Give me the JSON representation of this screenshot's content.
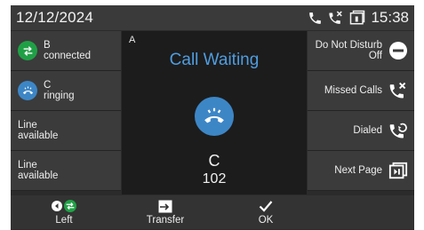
{
  "status": {
    "date": "12/12/2024",
    "time": "15:38",
    "icons": [
      "phone-icon",
      "missed-call-icon",
      "voicemail-tray-icon"
    ]
  },
  "left_keys": [
    {
      "line": "B",
      "state": "connected",
      "icon": "call-transfer-icon",
      "color": "#20a046"
    },
    {
      "line": "C",
      "state": "ringing",
      "icon": "ringing-phone-icon",
      "color": "#3d86c6"
    },
    {
      "line": "Line",
      "state": "available"
    },
    {
      "line": "Line",
      "state": "available"
    }
  ],
  "right_keys": [
    {
      "label": "Do Not Disturb",
      "sub": "Off",
      "icon": "dnd-icon"
    },
    {
      "label": "Missed Calls",
      "icon": "missed-calls-icon"
    },
    {
      "label": "Dialed",
      "icon": "dialed-calls-icon"
    },
    {
      "label": "Next Page",
      "icon": "next-page-icon"
    }
  ],
  "center": {
    "line_label": "A",
    "title": "Call Waiting",
    "caller_name": "C",
    "caller_number": "102",
    "accent": "#4f9de0"
  },
  "softkeys": [
    {
      "label": "Left",
      "icon": "left-arrow-transfer-icon"
    },
    {
      "label": "Transfer",
      "icon": "transfer-icon"
    },
    {
      "label": "OK",
      "icon": "check-icon"
    }
  ]
}
